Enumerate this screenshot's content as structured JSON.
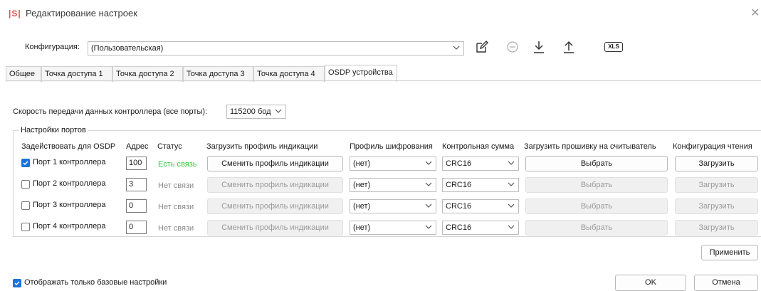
{
  "window": {
    "logo": "|S|",
    "title": "Редактирование настроек"
  },
  "config": {
    "label": "Конфигурация:",
    "value": "(Пользовательская)"
  },
  "toolbar": {
    "xls_label": "XLS"
  },
  "tabs": [
    {
      "label": "Общее"
    },
    {
      "label": "Точка доступа 1"
    },
    {
      "label": "Точка доступа 2"
    },
    {
      "label": "Точка доступа 3"
    },
    {
      "label": "Точка доступа 4"
    },
    {
      "label": "OSDP устройства"
    }
  ],
  "speed": {
    "label": "Скорость передачи данных контроллера (все порты):",
    "value": "115200 бод"
  },
  "ports": {
    "group_title": "Настройки портов",
    "headers": {
      "use": "Задействовать для OSDP",
      "address": "Адрес",
      "status": "Статус",
      "profile": "Загрузить профиль индикации",
      "encryption": "Профиль шифрования",
      "checksum": "Контрольная сумма",
      "firmware": "Загрузить прошивку на считыватель",
      "read_config": "Конфигурация чтения"
    },
    "rows": [
      {
        "label": "Порт 1 контроллера",
        "checked": true,
        "address": "100",
        "status": "Есть связь",
        "profile_btn": "Сменить профиль индикации",
        "encryption": "(нет)",
        "checksum": "CRC16",
        "firmware_btn": "Выбрать",
        "read_btn": "Загрузить"
      },
      {
        "label": "Порт 2 контроллера",
        "checked": false,
        "address": "3",
        "status": "Нет связи",
        "profile_btn": "Сменить профиль индикации",
        "encryption": "(нет)",
        "checksum": "CRC16",
        "firmware_btn": "Выбрать",
        "read_btn": "Загрузить"
      },
      {
        "label": "Порт 3 контроллера",
        "checked": false,
        "address": "0",
        "status": "Нет связи",
        "profile_btn": "Сменить профиль индикации",
        "encryption": "(нет)",
        "checksum": "CRC16",
        "firmware_btn": "Выбрать",
        "read_btn": "Загрузить"
      },
      {
        "label": "Порт 4 контроллера",
        "checked": false,
        "address": "0",
        "status": "Нет связи",
        "profile_btn": "Сменить профиль индикации",
        "encryption": "(нет)",
        "checksum": "CRC16",
        "firmware_btn": "Выбрать",
        "read_btn": "Загрузить"
      }
    ]
  },
  "apply_label": "Применить",
  "footer": {
    "basic_only_label": "Отображать только базовые настройки",
    "basic_only_checked": true,
    "ok_label": "OK",
    "cancel_label": "Отмена"
  },
  "colors": {
    "accent": "#1a73d9",
    "status_ok": "#2ecc40",
    "status_bad": "#8a8a8a",
    "logo": "#d9534f"
  }
}
